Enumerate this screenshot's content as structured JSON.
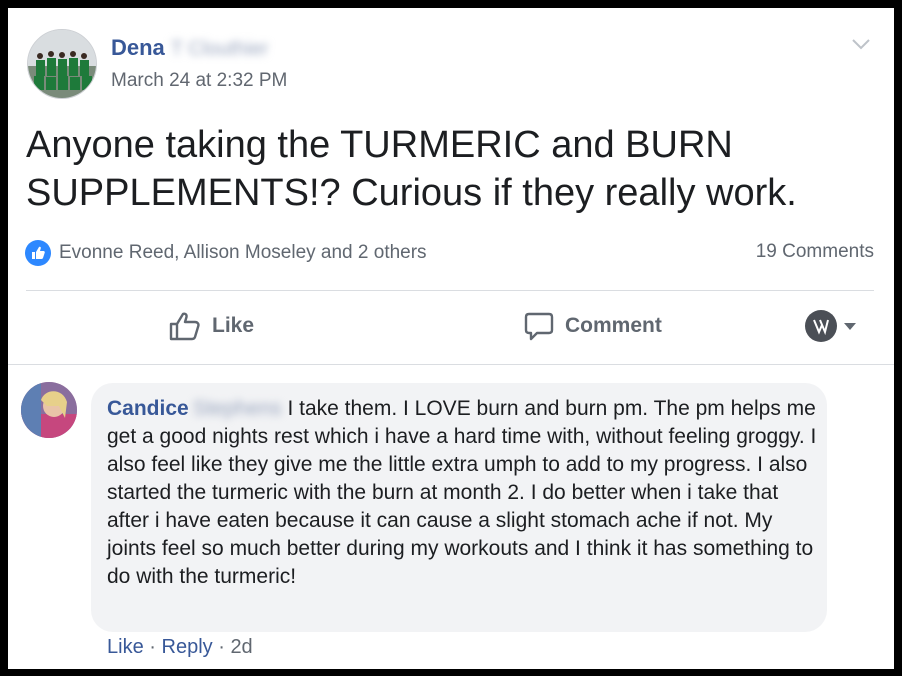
{
  "post": {
    "author_first": "Dena",
    "author_last_blurred": "T Clouthier",
    "timestamp": "March 24 at 2:32 PM",
    "text": "Anyone taking the TURMERIC and BURN SUPPLEMENTS!? Curious if they really work.",
    "reactors": "Evonne Reed, Allison Moseley and 2 others",
    "comment_count": "19 Comments",
    "like_label": "Like",
    "comment_label": "Comment"
  },
  "comment": {
    "author_first": "Candice",
    "author_last_blurred": "Stephens",
    "text": "I take them. I LOVE burn and burn pm. The pm helps me get a good nights rest which i have a hard time with, without feeling groggy. I also feel like they give me the little extra umph to add to my progress. I also started the turmeric with the burn at month 2. I do better when i take that after i have eaten because it can cause a slight stomach ache if not. My joints feel so much better during my workouts and I think it has something to do with the turmeric!",
    "like": "Like",
    "reply": "Reply",
    "separator": "·",
    "age": "2d"
  },
  "colors": {
    "link": "#385898",
    "like_blue": "#2d88ff",
    "bubble": "#f2f3f5"
  },
  "icons": [
    "chevron-down-icon",
    "like-reaction-icon",
    "thumbs-up-icon",
    "comment-icon",
    "page-avatar-icon",
    "caret-down-icon"
  ]
}
